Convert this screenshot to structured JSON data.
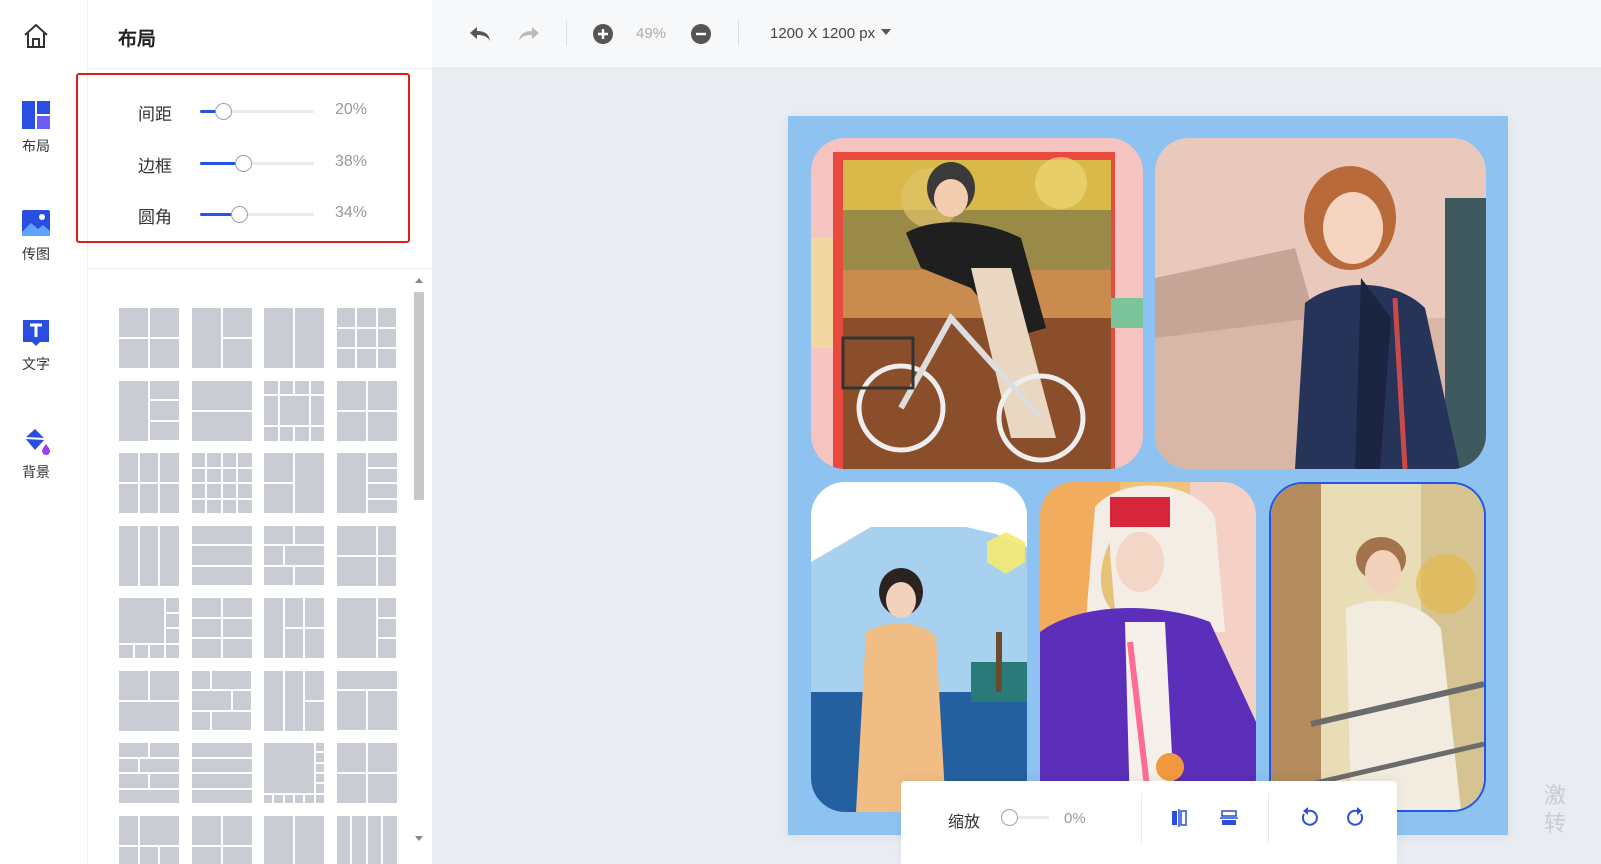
{
  "rail": {
    "items": [
      {
        "label": "布局",
        "icon": "layout-icon"
      },
      {
        "label": "传图",
        "icon": "upload-image-icon"
      },
      {
        "label": "文字",
        "icon": "text-icon"
      },
      {
        "label": "背景",
        "icon": "paint-bucket-icon"
      }
    ]
  },
  "panel": {
    "title": "布局",
    "settings": [
      {
        "label": "间距",
        "value": "20%",
        "level": 0.2
      },
      {
        "label": "边框",
        "value": "38%",
        "level": 0.38
      },
      {
        "label": "圆角",
        "value": "34%",
        "level": 0.34
      }
    ]
  },
  "toolbar": {
    "zoom": "49%",
    "canvas_size": "1200 X 1200 px"
  },
  "bottom_bar": {
    "zoom_label": "缩放",
    "zoom_value": "0%",
    "zoom_level": 0
  },
  "watermark": [
    "激",
    "转"
  ],
  "colors": {
    "accent": "#2155e8",
    "highlight_border": "#e31b1b",
    "canvas_bg": "#8ec2f0",
    "rail_icon": "#2a4fe0"
  }
}
